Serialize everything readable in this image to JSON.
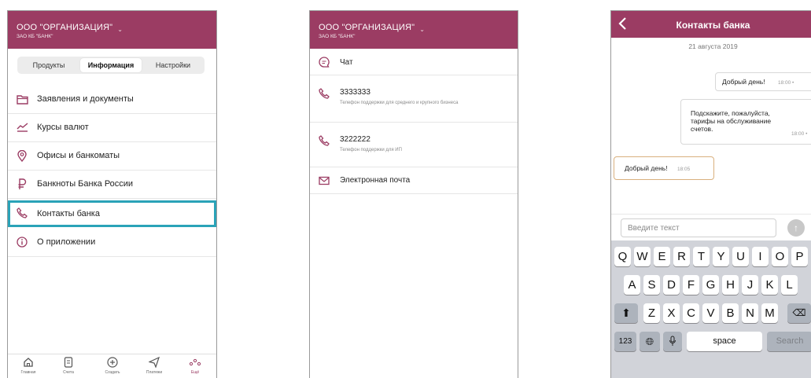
{
  "screen1": {
    "org_name": "ООО \"ОРГАНИЗАЦИЯ\"",
    "bank_name": "ЗАО КБ \"БАНК\"",
    "tabs": [
      "Продукты",
      "Информация",
      "Настройки"
    ],
    "active_tab": "Информация",
    "menu": [
      {
        "label": "Заявления и документы",
        "icon": "folder-icon"
      },
      {
        "label": "Курсы валют",
        "icon": "chart-icon"
      },
      {
        "label": "Офисы и банкоматы",
        "icon": "location-pin-icon"
      },
      {
        "label": "Банкноты Банка России",
        "icon": "ruble-icon"
      },
      {
        "label": "Контакты банка",
        "icon": "phone-icon",
        "highlighted": true
      },
      {
        "label": "О приложении",
        "icon": "info-icon"
      }
    ],
    "tabbar": [
      {
        "label": "Главная",
        "icon": "home-icon"
      },
      {
        "label": "Счета",
        "icon": "document-icon"
      },
      {
        "label": "Создать",
        "icon": "plus-circle-icon"
      },
      {
        "label": "Платежи",
        "icon": "send-icon"
      },
      {
        "label": "Ещё",
        "icon": "more-icon",
        "active": true
      }
    ]
  },
  "screen2": {
    "org_name": "ООО \"ОРГАНИЗАЦИЯ\"",
    "bank_name": "ЗАО КБ \"БАНК\"",
    "items": [
      {
        "label": "Чат",
        "icon": "chat-icon"
      },
      {
        "label": "3333333",
        "sub": "Телефон поддержки для среднего и крупного бизнеса",
        "icon": "phone-icon"
      },
      {
        "label": "3222222",
        "sub": "Телефон поддержки для ИП",
        "icon": "phone-icon"
      },
      {
        "label": "Электронная почта",
        "icon": "mail-icon"
      }
    ]
  },
  "screen3": {
    "title": "Контакты банка",
    "date": "21 августа 2019",
    "messages": [
      {
        "text": "Добрый день!",
        "time": "18:00 •"
      },
      {
        "text": "Подскажите, пожалуйста, тарифы на обслуживание счетов.",
        "time": "18:00 •"
      },
      {
        "text": "Добрый день!",
        "time": "18:05"
      }
    ],
    "input_placeholder": "Введите текст",
    "keyboard": {
      "row1": [
        "Q",
        "W",
        "E",
        "R",
        "T",
        "Y",
        "U",
        "I",
        "O",
        "P"
      ],
      "row2": [
        "A",
        "S",
        "D",
        "F",
        "G",
        "H",
        "J",
        "K",
        "L"
      ],
      "row3": [
        "Z",
        "X",
        "C",
        "V",
        "B",
        "N",
        "M"
      ],
      "num_key": "123",
      "space_key": "space",
      "search_key": "Search"
    }
  },
  "colors": {
    "brand": "#9b3c63",
    "highlight": "#2aa3b8"
  }
}
